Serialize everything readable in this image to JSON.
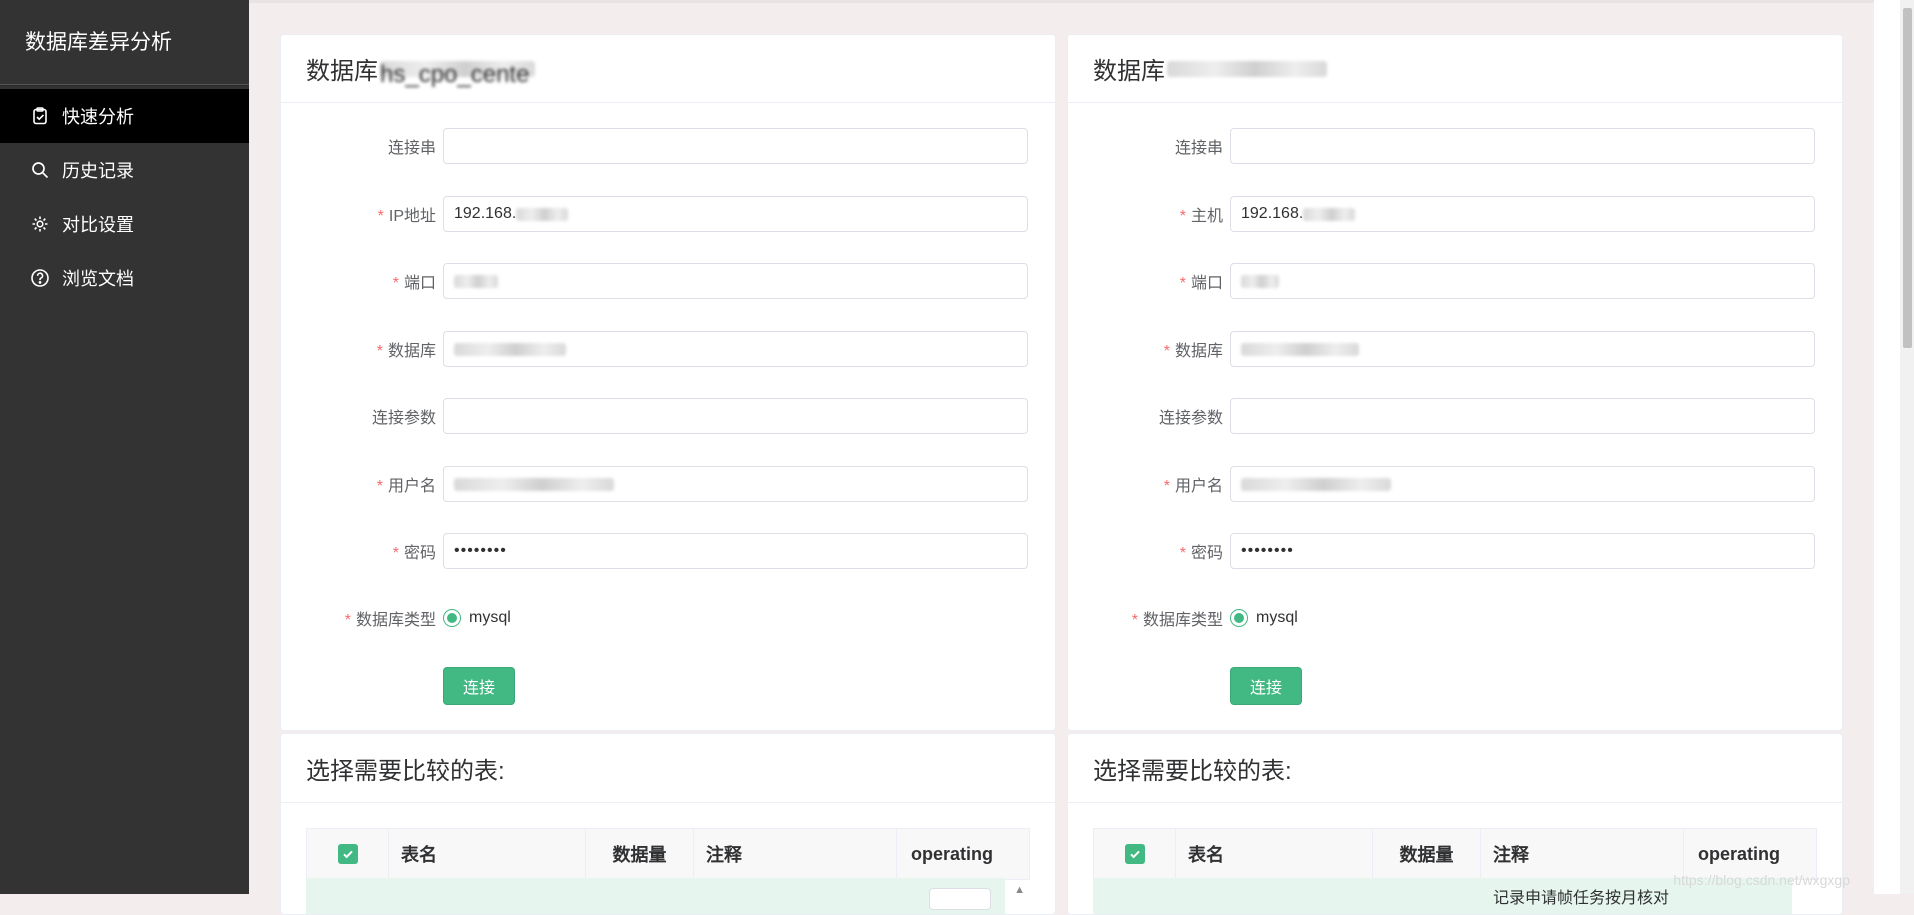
{
  "app_title": "数据库差异分析",
  "nav": [
    {
      "label": "快速分析",
      "icon": "clipboard-check-icon",
      "active": true
    },
    {
      "label": "历史记录",
      "icon": "search-icon",
      "active": false
    },
    {
      "label": "对比设置",
      "icon": "gear-icon",
      "active": false
    },
    {
      "label": "浏览文档",
      "icon": "question-circle-icon",
      "active": false
    }
  ],
  "left_db": {
    "title_prefix": "数据库",
    "title_suffix": "hs_cpo_cente",
    "fields": {
      "conn_label": "连接串",
      "host_label": "IP地址",
      "host_value": "192.168.",
      "port_label": "端口",
      "db_label": "数据库",
      "params_label": "连接参数",
      "user_label": "用户名",
      "pwd_label": "密码",
      "pwd_value": "••••••••",
      "type_label": "数据库类型",
      "type_value": "mysql"
    },
    "connect_label": "连接"
  },
  "right_db": {
    "title_prefix": "数据库",
    "fields": {
      "conn_label": "连接串",
      "host_label": "主机",
      "host_value": "192.168.",
      "port_label": "端口",
      "db_label": "数据库",
      "params_label": "连接参数",
      "user_label": "用户名",
      "pwd_label": "密码",
      "pwd_value": "••••••••",
      "type_label": "数据库类型",
      "type_value": "mysql"
    },
    "connect_label": "连接"
  },
  "tables_section": {
    "title": "选择需要比较的表:",
    "columns": [
      "表名",
      "数据量",
      "注释",
      "operating"
    ],
    "right_first_row_note": "记录申请帧任务按月核对"
  },
  "watermark": "https://blog.csdn.net/wxgxgp"
}
